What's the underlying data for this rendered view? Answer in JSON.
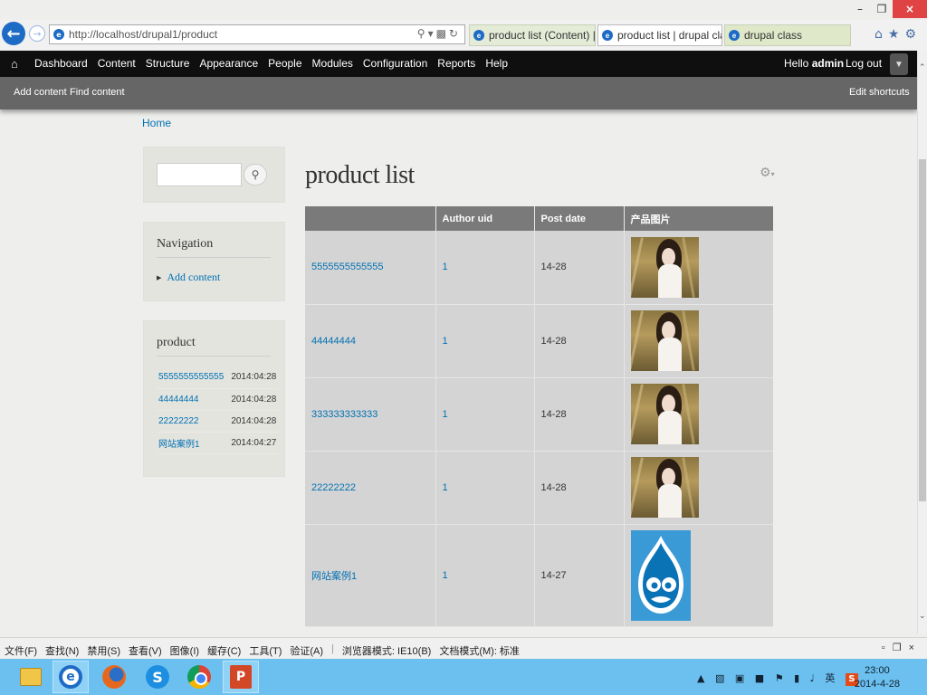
{
  "browser": {
    "url": "http://localhost/drupal1/product",
    "tabs": [
      {
        "label": "product list (Content) | dr..."
      },
      {
        "label": "product list | drupal cla..."
      },
      {
        "label": "drupal class"
      }
    ]
  },
  "toolbar": {
    "menu": [
      "Dashboard",
      "Content",
      "Structure",
      "Appearance",
      "People",
      "Modules",
      "Configuration",
      "Reports",
      "Help"
    ],
    "hello_prefix": "Hello ",
    "username": "admin",
    "logout": "Log out"
  },
  "shortcuts": {
    "add_content": "Add content",
    "find_content": "Find content",
    "edit_shortcuts": "Edit shortcuts"
  },
  "breadcrumb": "Home",
  "sidebar": {
    "search_placeholder": "",
    "navigation_title": "Navigation",
    "navigation_link": "Add content",
    "product_title": "product",
    "product_rows": [
      {
        "title": "5555555555555",
        "date": "2014:04:28"
      },
      {
        "title": "44444444",
        "date": "2014:04:28"
      },
      {
        "title": "22222222",
        "date": "2014:04:28"
      },
      {
        "title": "网站案例1",
        "date": "2014:04:27"
      }
    ]
  },
  "main": {
    "title": "product list",
    "columns": [
      "",
      "Author uid",
      "Post date",
      "产品图片"
    ],
    "rows": [
      {
        "title": "5555555555555",
        "uid": "1",
        "date": "14-28",
        "image": "photo"
      },
      {
        "title": "44444444",
        "uid": "1",
        "date": "14-28",
        "image": "photo"
      },
      {
        "title": "333333333333",
        "uid": "1",
        "date": "14-28",
        "image": "photo"
      },
      {
        "title": "22222222",
        "uid": "1",
        "date": "14-28",
        "image": "photo"
      },
      {
        "title": "网站案例1",
        "uid": "1",
        "date": "14-27",
        "image": "drupal-logo"
      }
    ]
  },
  "cmdbar": {
    "items": [
      "文件(F)",
      "查找(N)",
      "禁用(S)",
      "查看(V)",
      "图像(I)",
      "缓存(C)",
      "工具(T)",
      "验证(A)"
    ],
    "browser_mode": "浏览器模式: IE10(B)",
    "doc_mode": "文档模式(M): 标准"
  },
  "taskbar": {
    "time": "23:00",
    "date": "2014-4-28",
    "ime": "英"
  },
  "colors": {
    "link": "#0071b3",
    "toolbar_bg": "#0f0f0f",
    "shortcut_bg": "#666666",
    "table_header": "#7a7a7a",
    "taskbar": "#6cc0f0"
  }
}
